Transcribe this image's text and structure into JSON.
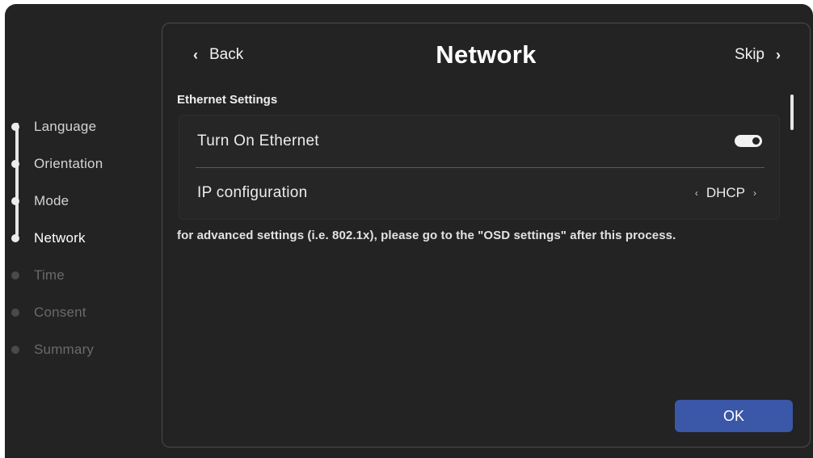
{
  "steps": [
    {
      "label": "Language",
      "state": "done"
    },
    {
      "label": "Orientation",
      "state": "done"
    },
    {
      "label": "Mode",
      "state": "done"
    },
    {
      "label": "Network",
      "state": "active"
    },
    {
      "label": "Time",
      "state": "pending"
    },
    {
      "label": "Consent",
      "state": "pending"
    },
    {
      "label": "Summary",
      "state": "pending"
    }
  ],
  "header": {
    "back_label": "Back",
    "title": "Network",
    "skip_label": "Skip",
    "back_icon": "chevron-left-icon",
    "skip_icon": "chevron-right-icon"
  },
  "ethernet": {
    "section_label": "Ethernet Settings",
    "turn_on_label": "Turn On Ethernet",
    "turn_on_value": true,
    "ip_config_label": "IP configuration",
    "ip_config_value": "DHCP"
  },
  "note": "for advanced settings (i.e. 802.1x), please go to the \"OSD settings\" after this process.",
  "ok_label": "OK",
  "colors": {
    "background": "#232323",
    "accent_button": "#3a57a8",
    "panel_border": "#4b4b4b"
  }
}
